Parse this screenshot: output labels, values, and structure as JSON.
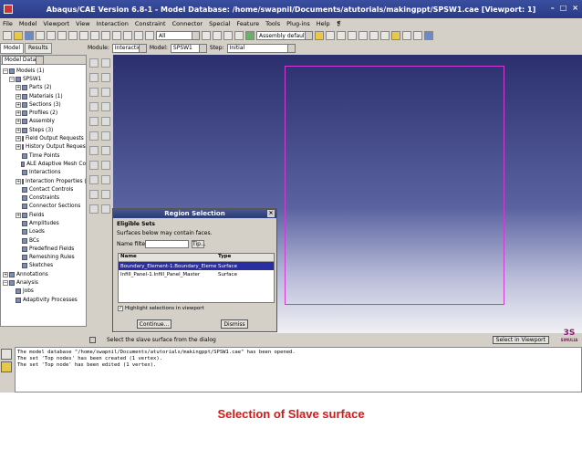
{
  "window": {
    "title": "Abaqus/CAE Version 6.8-1 - Model Database: /home/swapnil/Documents/atutorials/makingppt/SPSW1.cae [Viewport: 1]"
  },
  "menu": [
    "File",
    "Model",
    "Viewport",
    "View",
    "Interaction",
    "Constraint",
    "Connector",
    "Special",
    "Feature",
    "Tools",
    "Plug-ins",
    "Help",
    "❡"
  ],
  "toolbar": {
    "filter_value": "All",
    "assembly_defaults": "Assembly defaults"
  },
  "context": {
    "module_label": "Module:",
    "module_value": "Interaction",
    "model_label": "Model:",
    "model_value": "SPSW1",
    "step_label": "Step:",
    "step_value": "Initial"
  },
  "left_tabs": [
    "Model",
    "Results"
  ],
  "tree_header": {
    "value": "Model Datab"
  },
  "tree": [
    {
      "label": "Models (1)",
      "pm": "−",
      "indent": 0
    },
    {
      "label": "SPSW1",
      "pm": "−",
      "indent": 1
    },
    {
      "label": "Parts (2)",
      "pm": "+",
      "indent": 2
    },
    {
      "label": "Materials (1)",
      "pm": "+",
      "indent": 2
    },
    {
      "label": "Sections (3)",
      "pm": "+",
      "indent": 2
    },
    {
      "label": "Profiles (2)",
      "pm": "+",
      "indent": 2
    },
    {
      "label": "Assembly",
      "pm": "+",
      "indent": 2
    },
    {
      "label": "Steps (3)",
      "pm": "+",
      "indent": 2
    },
    {
      "label": "Field Output Requests (",
      "pm": "+",
      "indent": 2
    },
    {
      "label": "History Output Requests",
      "pm": "+",
      "indent": 2
    },
    {
      "label": "Time Points",
      "pm": "",
      "indent": 2
    },
    {
      "label": "ALE Adaptive Mesh Co",
      "pm": "",
      "indent": 2
    },
    {
      "label": "Interactions",
      "pm": "",
      "indent": 2
    },
    {
      "label": "Interaction Properties (1",
      "pm": "+",
      "indent": 2
    },
    {
      "label": "Contact Controls",
      "pm": "",
      "indent": 2
    },
    {
      "label": "Constraints",
      "pm": "",
      "indent": 2
    },
    {
      "label": "Connector Sections",
      "pm": "",
      "indent": 2
    },
    {
      "label": "Fields",
      "pm": "+",
      "indent": 2
    },
    {
      "label": "Amplitudes",
      "pm": "",
      "indent": 2
    },
    {
      "label": "Loads",
      "pm": "",
      "indent": 2
    },
    {
      "label": "BCs",
      "pm": "",
      "indent": 2
    },
    {
      "label": "Predefined Fields",
      "pm": "",
      "indent": 2
    },
    {
      "label": "Remeshing Rules",
      "pm": "",
      "indent": 2
    },
    {
      "label": "Sketches",
      "pm": "",
      "indent": 2
    },
    {
      "label": "Annotations",
      "pm": "+",
      "indent": 0
    },
    {
      "label": "Analysis",
      "pm": "−",
      "indent": 0
    },
    {
      "label": "Jobs",
      "pm": "",
      "indent": 1
    },
    {
      "label": "Adaptivity Processes",
      "pm": "",
      "indent": 1
    }
  ],
  "dialog": {
    "title": "Region Selection",
    "close": "×",
    "section": "Eligible Sets",
    "note": "Surfaces below may contain faces.",
    "filter_label": "Name filter:",
    "tip_button": "Tip...",
    "headers": [
      "Name",
      "Type"
    ],
    "rows": [
      {
        "name": "Boundary_Element-1.Boundary_Element_Sl",
        "type": "Surface",
        "selected": true
      },
      {
        "name": "Infill_Panel-1.Infill_Panel_Master",
        "type": "Surface",
        "selected": false
      }
    ],
    "highlight_label": "Highlight selections in viewport",
    "continue_button": "Continue...",
    "dismiss_button": "Dismiss"
  },
  "prompt": {
    "text": "Select the slave surface from the dialog",
    "select_in_viewport": "Select in Viewport"
  },
  "messages": [
    "The model database \"/home/swapnil/Documents/atutorials/makingppt/SPSW1.cae\" has been opened.",
    "The set 'Top nodes' has been created (1 vertex).",
    "The set 'Top node' has been edited (1 vertex)."
  ],
  "logo": {
    "text": "3S",
    "sub": "SIMULIA"
  },
  "caption": "Selection of Slave surface",
  "colors": {
    "viewport_top": "#2b2f6d",
    "highlight": "#d23ad8",
    "caption": "#d11a1a",
    "selection": "#2a2ea0"
  }
}
